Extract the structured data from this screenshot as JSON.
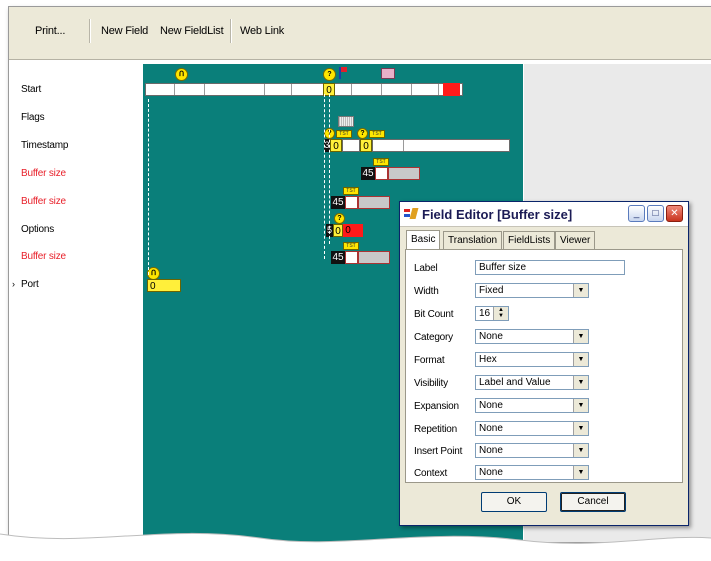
{
  "toolbar": {
    "print": "Print...",
    "new_field": "New Field",
    "new_fieldlist": "New FieldList",
    "web_link": "Web Link"
  },
  "rows": [
    {
      "label": "Start",
      "color": "black"
    },
    {
      "label": "Flags",
      "color": "black"
    },
    {
      "label": "Timestamp",
      "color": "black"
    },
    {
      "label": "Buffer size",
      "color": "red"
    },
    {
      "label": "Buffer size",
      "color": "red"
    },
    {
      "label": "Options",
      "color": "black"
    },
    {
      "label": "Buffer size",
      "color": "red"
    },
    {
      "label": "Port",
      "color": "black"
    }
  ],
  "canvas": {
    "start_value": "0",
    "timestamp_a": "0",
    "timestamp_b": "0",
    "buffer1": "45",
    "buffer2": "45",
    "options_a": "0",
    "options_b": "0",
    "buffer3": "45",
    "port_value": "0",
    "port_prefix": "5",
    "ts_prefix": "3"
  },
  "dialog": {
    "title": "Field Editor [Buffer size]",
    "tabs": [
      "Basic",
      "Translation",
      "FieldLists",
      "Viewer"
    ],
    "fields": [
      {
        "label": "Label",
        "value": "Buffer size",
        "type": "text"
      },
      {
        "label": "Width",
        "value": "Fixed",
        "type": "select"
      },
      {
        "label": "Bit Count",
        "value": "16",
        "type": "spin"
      },
      {
        "label": "Category",
        "value": "None",
        "type": "select"
      },
      {
        "label": "Format",
        "value": "Hex",
        "type": "select"
      },
      {
        "label": "Visibility",
        "value": "Label and Value",
        "type": "select"
      },
      {
        "label": "Expansion",
        "value": "None",
        "type": "select"
      },
      {
        "label": "Repetition",
        "value": "None",
        "type": "select"
      },
      {
        "label": "Insert Point",
        "value": "None",
        "type": "select"
      },
      {
        "label": "Context",
        "value": "None",
        "type": "select"
      }
    ],
    "ok": "OK",
    "cancel": "Cancel"
  },
  "colors": {
    "canvas_bg": "#0a7f7a",
    "red_label": "#e8202a",
    "field_yellow": "#ffef3a",
    "field_red": "#ff1a1a"
  }
}
